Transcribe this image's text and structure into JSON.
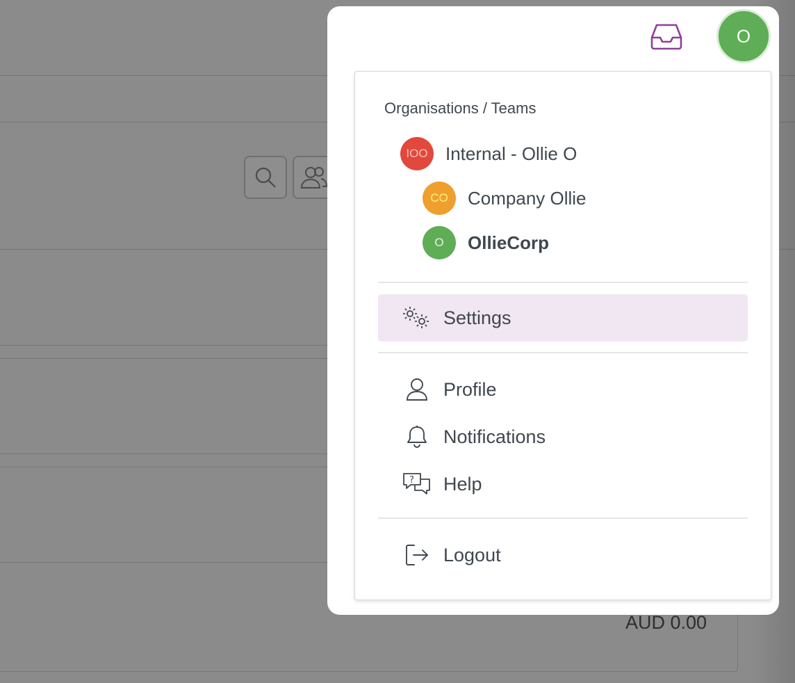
{
  "background": {
    "amount_text": "AUD 0.00"
  },
  "header": {
    "user_avatar_initial": "O",
    "inbox_icon": "inbox-icon",
    "accent_color": "#8e3f9a"
  },
  "menu": {
    "organisations_heading": "Organisations / Teams",
    "organisations": [
      {
        "initials": "IOO",
        "name": "Internal - Ollie O",
        "color": "#e2483c",
        "text_color": "#f6c2bd",
        "active": false
      },
      {
        "initials": "CO",
        "name": "Company Ollie",
        "color": "#ef9f2e",
        "text_color": "#fff27a",
        "active": false
      },
      {
        "initials": "O",
        "name": "OllieCorp",
        "color": "#5fad56",
        "text_color": "#e4f6df",
        "active": true
      }
    ],
    "settings": {
      "label": "Settings",
      "icon": "gears-icon"
    },
    "profile": {
      "label": "Profile",
      "icon": "user-icon"
    },
    "notifications": {
      "label": "Notifications",
      "icon": "bell-icon"
    },
    "help": {
      "label": "Help",
      "icon": "chat-question-icon"
    },
    "logout": {
      "label": "Logout",
      "icon": "logout-icon"
    }
  }
}
